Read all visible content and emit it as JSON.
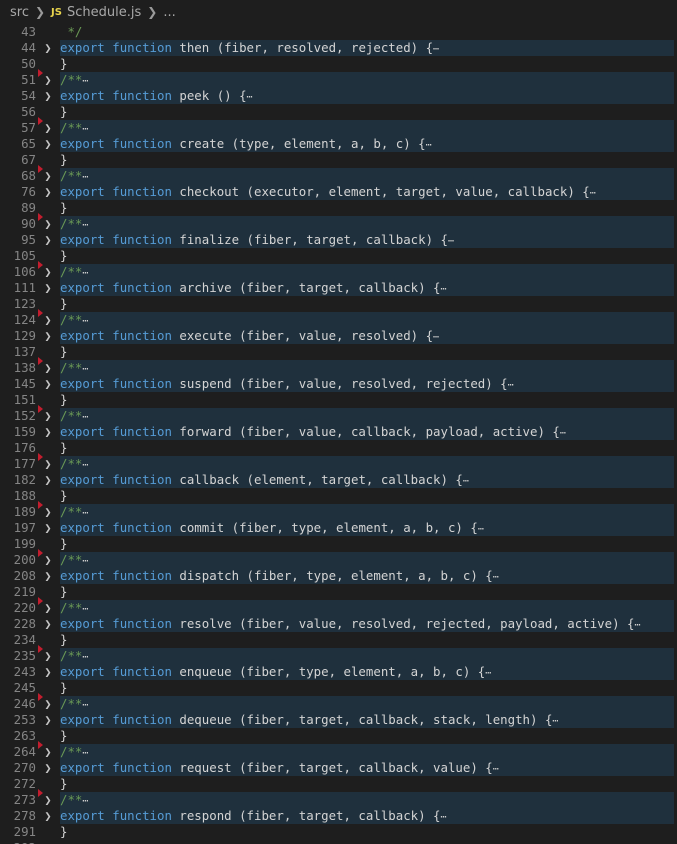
{
  "breadcrumb": {
    "folder": "src",
    "file_icon": "JS",
    "file": "Schedule.js",
    "more": "..."
  },
  "editor": {
    "keyword_export": "export",
    "keyword_function": "function",
    "doc_open": "/**",
    "doc_ellipsis": "⋯",
    "body_ellipsis": "⋯",
    "top_partial": {
      "number": "43",
      "text": "*/"
    },
    "bottom_partial": {
      "number": "292"
    },
    "blocks": [
      {
        "comment_line": null,
        "fn_line": "44",
        "name": "then",
        "params": "(fiber, resolved, rejected)",
        "close_line": "50"
      },
      {
        "comment_line": "51",
        "fn_line": "54",
        "name": "peek",
        "params": "()",
        "close_line": "56"
      },
      {
        "comment_line": "57",
        "fn_line": "65",
        "name": "create",
        "params": "(type, element, a, b, c)",
        "close_line": "67"
      },
      {
        "comment_line": "68",
        "fn_line": "76",
        "name": "checkout",
        "params": "(executor, element, target, value, callback)",
        "close_line": "89"
      },
      {
        "comment_line": "90",
        "fn_line": "95",
        "name": "finalize",
        "params": "(fiber, target, callback)",
        "close_line": "105"
      },
      {
        "comment_line": "106",
        "fn_line": "111",
        "name": "archive",
        "params": "(fiber, target, callback)",
        "close_line": "123"
      },
      {
        "comment_line": "124",
        "fn_line": "129",
        "name": "execute",
        "params": "(fiber, value, resolved)",
        "close_line": "137"
      },
      {
        "comment_line": "138",
        "fn_line": "145",
        "name": "suspend",
        "params": "(fiber, value, resolved, rejected)",
        "close_line": "151"
      },
      {
        "comment_line": "152",
        "fn_line": "159",
        "name": "forward",
        "params": "(fiber, value, callback, payload, active)",
        "close_line": "176"
      },
      {
        "comment_line": "177",
        "fn_line": "182",
        "name": "callback",
        "params": "(element, target, callback)",
        "close_line": "188"
      },
      {
        "comment_line": "189",
        "fn_line": "197",
        "name": "commit",
        "params": "(fiber, type, element, a, b, c)",
        "close_line": "199"
      },
      {
        "comment_line": "200",
        "fn_line": "208",
        "name": "dispatch",
        "params": "(fiber, type, element, a, b, c)",
        "close_line": "219"
      },
      {
        "comment_line": "220",
        "fn_line": "228",
        "name": "resolve",
        "params": "(fiber, value, resolved, rejected, payload, active)",
        "close_line": "234"
      },
      {
        "comment_line": "235",
        "fn_line": "243",
        "name": "enqueue",
        "params": "(fiber, type, element, a, b, c)",
        "close_line": "245"
      },
      {
        "comment_line": "246",
        "fn_line": "253",
        "name": "dequeue",
        "params": "(fiber, target, callback, stack, length)",
        "close_line": "263"
      },
      {
        "comment_line": "264",
        "fn_line": "270",
        "name": "request",
        "params": "(fiber, target, callback, value)",
        "close_line": "272"
      },
      {
        "comment_line": "273",
        "fn_line": "278",
        "name": "respond",
        "params": "(fiber, target, callback)",
        "close_line": "291"
      }
    ]
  },
  "colors": {
    "background": "#1e1e1e",
    "folded_highlight": "#1f303d",
    "keyword": "#569cd6",
    "comment": "#6a9955",
    "line_number": "#858585",
    "breakpoint_marker": "#c21d2e"
  }
}
